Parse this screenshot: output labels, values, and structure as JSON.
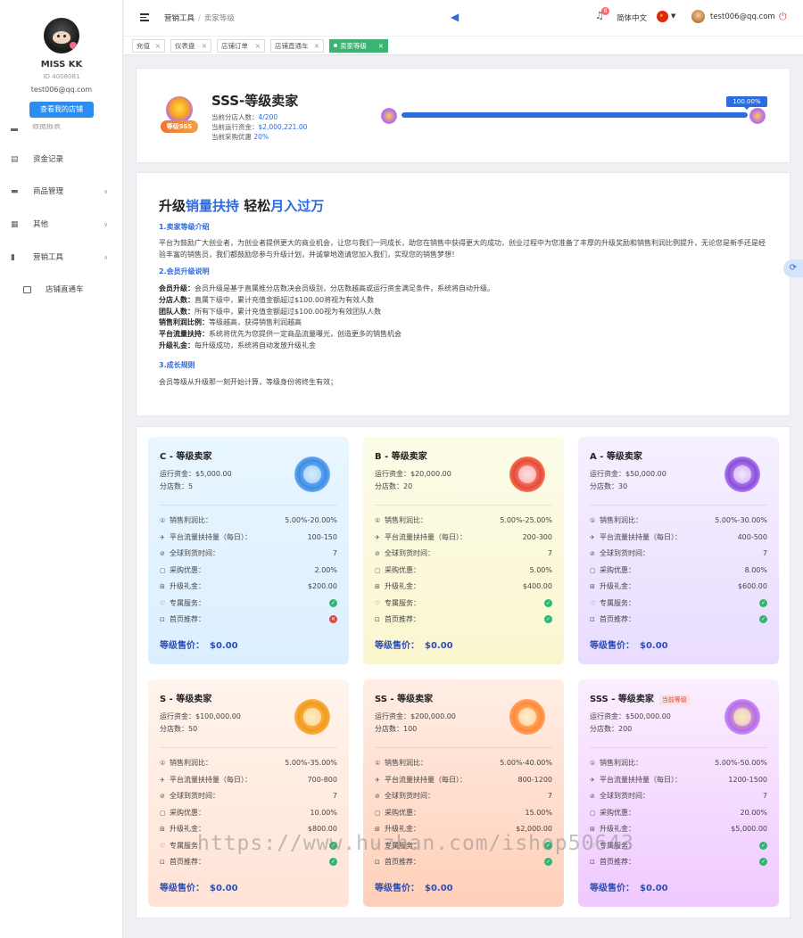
{
  "sidebar": {
    "username": "MISS KK",
    "user_id": "ID 4008081",
    "email": "test006@qq.com",
    "shop_button": "查看我的店铺",
    "partial_item": "数据报表",
    "items": [
      {
        "label": "资金记录",
        "icon": "wallet-icon"
      },
      {
        "label": "商品管理",
        "icon": "goods-icon"
      },
      {
        "label": "其他",
        "icon": "grid-icon"
      },
      {
        "label": "营销工具",
        "icon": "chart-icon"
      }
    ],
    "sub_items": [
      {
        "label": "店铺直通车",
        "icon": "truck-icon"
      }
    ]
  },
  "header": {
    "breadcrumb": [
      "营销工具",
      "卖家等级"
    ],
    "notification_count": "8",
    "language": "简体中文",
    "user_email": "test006@qq.com"
  },
  "tabs": [
    "充值",
    "仪表盘",
    "店铺订单",
    "店铺直通车",
    "卖家等级"
  ],
  "current_level": {
    "badge_text": "等级SSS",
    "title": "SSS-等级卖家",
    "lines": [
      {
        "label": "当前分店人数：",
        "value": "4/200"
      },
      {
        "label": "当前运行资金：",
        "value": "$2,000,221.00"
      },
      {
        "label": "当前采购优惠",
        "value": "20%"
      }
    ],
    "progress_label": "100.00%",
    "progress": 1.0
  },
  "intro": {
    "title_a": "升级",
    "title_b": "销量扶持",
    "title_c": " 轻松",
    "title_d": "月入过万",
    "sec1": "1.卖家等级介绍",
    "para1": "平台为鼓励广大创业者，为创业者提供更大的商业机会，让您与我们一同成长，助您在销售中获得更大的成功，创业过程中为您准备了丰厚的升级奖励和销售利润比例提升，无论您是新手还是经验丰富的销售员，我们都鼓励您参与升级计划，并诚挚地邀请您加入我们，实现您的销售梦想！",
    "sec2": "2.会员升级说明",
    "rules": [
      {
        "k": "会员升级：",
        "v": "会员升级是基于直属推分店数决会员级别，分店数越高或运行资金满足条件，系统将自动升级。"
      },
      {
        "k": "分店人数：",
        "v": "直属下级中，累计充值金额超过$100.00将视为有效人数"
      },
      {
        "k": "团队人数：",
        "v": "所有下级中，累计充值金额超过$100.00视为有效团队人数"
      },
      {
        "k": "销售利润比例：",
        "v": "等级越高，获得销售利润越高"
      },
      {
        "k": "平台流量扶持：",
        "v": "系统将优先为您提供一定商品流量曝光，创造更多的销售机会"
      },
      {
        "k": "升级礼金：",
        "v": "每升级成功，系统将自动发放升级礼金"
      }
    ],
    "sec3": "3.成长规则",
    "para3": "会员等级从升级那一刻开始计算，等级身份将终生有效；"
  },
  "levels": [
    {
      "title": "C - 等级卖家",
      "fund": "运行资金：$5,000.00",
      "shops": "分店数：5",
      "profit": "5.00%-20.00%",
      "traffic": "100-150",
      "delivery": "7",
      "discount": "2.00%",
      "gift": "$200.00",
      "exclusive": "ok",
      "homepage": "no",
      "price_label": "等级售价：",
      "price": "$0.00",
      "current": ""
    },
    {
      "title": "B - 等级卖家",
      "fund": "运行资金：$20,000.00",
      "shops": "分店数：20",
      "profit": "5.00%-25.00%",
      "traffic": "200-300",
      "delivery": "7",
      "discount": "5.00%",
      "gift": "$400.00",
      "exclusive": "ok",
      "homepage": "ok",
      "price_label": "等级售价：",
      "price": "$0.00",
      "current": ""
    },
    {
      "title": "A - 等级卖家",
      "fund": "运行资金：$50,000.00",
      "shops": "分店数：30",
      "profit": "5.00%-30.00%",
      "traffic": "400-500",
      "delivery": "7",
      "discount": "8.00%",
      "gift": "$600.00",
      "exclusive": "ok",
      "homepage": "ok",
      "price_label": "等级售价：",
      "price": "$0.00",
      "current": ""
    },
    {
      "title": "S - 等级卖家",
      "fund": "运行资金：$100,000.00",
      "shops": "分店数：50",
      "profit": "5.00%-35.00%",
      "traffic": "700-800",
      "delivery": "7",
      "discount": "10.00%",
      "gift": "$800.00",
      "exclusive": "ok",
      "homepage": "ok",
      "price_label": "等级售价：",
      "price": "$0.00",
      "current": ""
    },
    {
      "title": "SS - 等级卖家",
      "fund": "运行资金：$200,000.00",
      "shops": "分店数：100",
      "profit": "5.00%-40.00%",
      "traffic": "800-1200",
      "delivery": "7",
      "discount": "15.00%",
      "gift": "$2,000.00",
      "exclusive": "ok",
      "homepage": "ok",
      "price_label": "等级售价：",
      "price": "$0.00",
      "current": ""
    },
    {
      "title": "SSS - 等级卖家",
      "fund": "运行资金：$500,000.00",
      "shops": "分店数：200",
      "profit": "5.00%-50.00%",
      "traffic": "1200-1500",
      "delivery": "7",
      "discount": "20.00%",
      "gift": "$5,000.00",
      "exclusive": "ok",
      "homepage": "ok",
      "price_label": "等级售价：",
      "price": "$0.00",
      "current": "当前等级"
    }
  ],
  "row_labels": [
    "销售利润比：",
    "平台流量扶持量（每日）：",
    "全球到货时间：",
    "采购优惠：",
    "升级礼金：",
    "专属服务：",
    "首页推荐："
  ],
  "watermark": "https://www.huzhan.com/ishop50643",
  "colors": {
    "accent": "#2d6cdf",
    "tag_active": "#3cb371",
    "ok": "#2bb673",
    "no": "#e0463f"
  }
}
